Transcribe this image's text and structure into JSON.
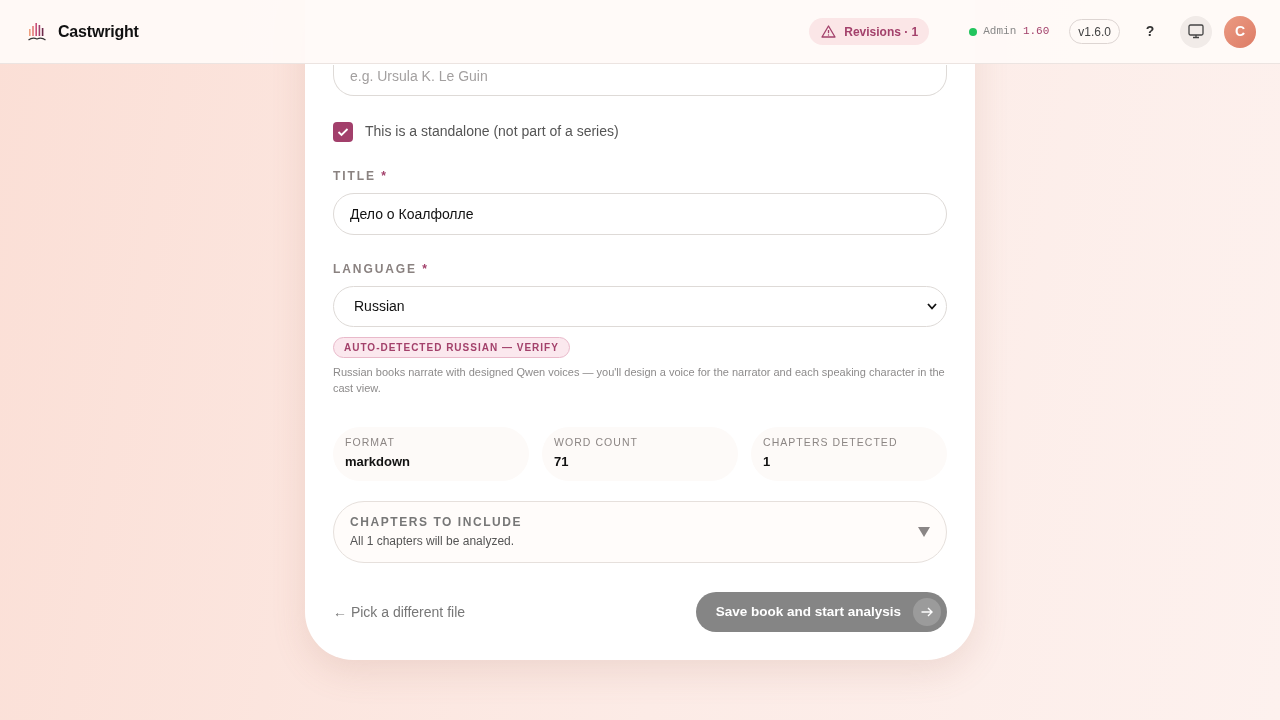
{
  "header": {
    "brand": "Castwright",
    "revisions": {
      "label": "Revisions · 1"
    },
    "status": {
      "online": true,
      "label": "Admin",
      "value": "1.60"
    },
    "version": "v1.6.0",
    "help": "?",
    "avatar": "C"
  },
  "form": {
    "author": {
      "placeholder": "e.g. Ursula K. Le Guin"
    },
    "standalone": {
      "label": "This is a standalone (not part of a series)",
      "checked": true
    },
    "title": {
      "label": "TITLE",
      "required_mark": "*",
      "value": "Дело о Коалфолле"
    },
    "language": {
      "label": "LANGUAGE",
      "required_mark": "*",
      "value": "Russian"
    },
    "detected_badge": "AUTO-DETECTED RUSSIAN — VERIFY",
    "language_note": "Russian books narrate with designed Qwen voices — you'll design a voice for the narrator and each speaking character in the cast view.",
    "stats": [
      {
        "label": "FORMAT",
        "value": "markdown"
      },
      {
        "label": "WORD COUNT",
        "value": "71"
      },
      {
        "label": "CHAPTERS DETECTED",
        "value": "1"
      }
    ],
    "chapters": {
      "label": "CHAPTERS TO INCLUDE",
      "summary": "All 1 chapters will be analyzed.",
      "expanded": false
    },
    "back_link": "← Pick a different file",
    "submit": {
      "label": "Save book and start analysis",
      "disabled": true
    }
  }
}
